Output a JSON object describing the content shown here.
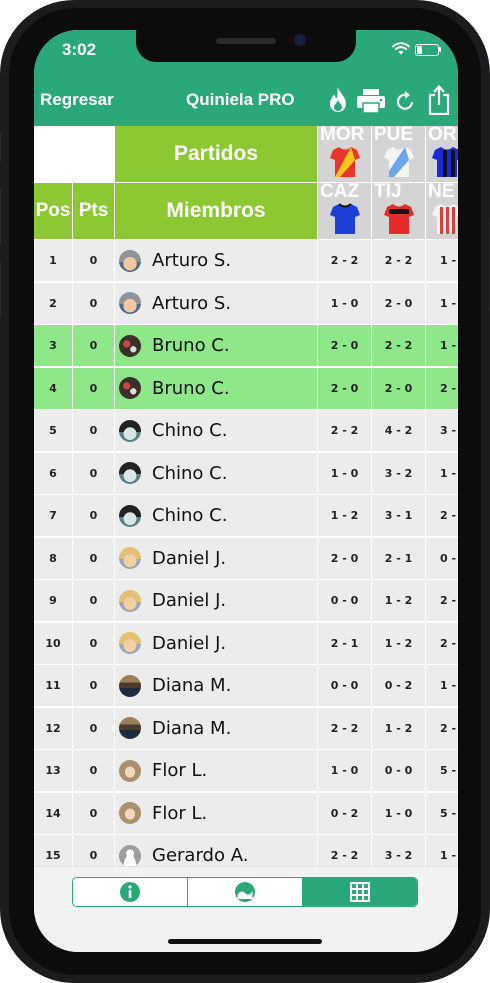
{
  "status": {
    "time": "3:02"
  },
  "nav": {
    "back_label": "Regresar",
    "title": "Quiniela PRO"
  },
  "header": {
    "partidos_label": "Partidos",
    "pos_label": "Pos",
    "pts_label": "Pts",
    "miembros_label": "Miembros"
  },
  "teams_row1": [
    {
      "abbr": "MOR",
      "jersey": "red-sash"
    },
    {
      "abbr": "PUE",
      "jersey": "white-blue-sash"
    },
    {
      "abbr": "OR",
      "jersey": "blue-black-stripes"
    }
  ],
  "teams_row2": [
    {
      "abbr": "CAZ",
      "jersey": "blue"
    },
    {
      "abbr": "TIJ",
      "jersey": "red-black"
    },
    {
      "abbr": "NE",
      "jersey": "red-white-stripes"
    }
  ],
  "colors": {
    "brand_green": "#2aa879",
    "header_green": "#8bc832",
    "highlight_row": "#8ee88a",
    "row_bg": "#ececec"
  },
  "rows": [
    {
      "pos": "1",
      "pts": "0",
      "name": "Arturo S.",
      "s1": "2 - 2",
      "s2": "2 - 2",
      "s3": "1 -",
      "avatar": "gray-hair",
      "highlight": false
    },
    {
      "pos": "2",
      "pts": "0",
      "name": "Arturo S.",
      "s1": "1 - 0",
      "s2": "2 - 0",
      "s3": "1 -",
      "avatar": "gray-hair",
      "highlight": false
    },
    {
      "pos": "3",
      "pts": "0",
      "name": "Bruno C.",
      "s1": "2 - 0",
      "s2": "2 - 2",
      "s3": "1 -",
      "avatar": "dark-pattern",
      "highlight": true
    },
    {
      "pos": "4",
      "pts": "0",
      "name": "Bruno C.",
      "s1": "2 - 0",
      "s2": "2 - 0",
      "s3": "2 -",
      "avatar": "dark-pattern",
      "highlight": true
    },
    {
      "pos": "5",
      "pts": "0",
      "name": "Chino C.",
      "s1": "2 - 2",
      "s2": "4 - 2",
      "s3": "3 -",
      "avatar": "black-hair",
      "highlight": false
    },
    {
      "pos": "6",
      "pts": "0",
      "name": "Chino C.",
      "s1": "1 - 0",
      "s2": "3 - 2",
      "s3": "1 -",
      "avatar": "black-hair",
      "highlight": false
    },
    {
      "pos": "7",
      "pts": "0",
      "name": "Chino C.",
      "s1": "1 - 2",
      "s2": "3 - 1",
      "s3": "2 -",
      "avatar": "black-hair",
      "highlight": false
    },
    {
      "pos": "8",
      "pts": "0",
      "name": "Daniel J.",
      "s1": "2 - 0",
      "s2": "2 - 1",
      "s3": "0 -",
      "avatar": "blonde",
      "highlight": false
    },
    {
      "pos": "9",
      "pts": "0",
      "name": "Daniel J.",
      "s1": "0 - 0",
      "s2": "1 - 2",
      "s3": "2 -",
      "avatar": "blonde",
      "highlight": false
    },
    {
      "pos": "10",
      "pts": "0",
      "name": "Daniel J.",
      "s1": "2 - 1",
      "s2": "1 - 2",
      "s3": "2 -",
      "avatar": "blonde",
      "highlight": false
    },
    {
      "pos": "11",
      "pts": "0",
      "name": "Diana M.",
      "s1": "0 - 0",
      "s2": "0 - 2",
      "s3": "1 -",
      "avatar": "landscape",
      "highlight": false
    },
    {
      "pos": "12",
      "pts": "0",
      "name": "Diana M.",
      "s1": "2 - 2",
      "s2": "1 - 2",
      "s3": "2 -",
      "avatar": "landscape",
      "highlight": false
    },
    {
      "pos": "13",
      "pts": "0",
      "name": "Flor L.",
      "s1": "1 - 0",
      "s2": "0 - 0",
      "s3": "5 -",
      "avatar": "woman",
      "highlight": false
    },
    {
      "pos": "14",
      "pts": "0",
      "name": "Flor L.",
      "s1": "0 - 2",
      "s2": "1 - 0",
      "s3": "5 -",
      "avatar": "woman",
      "highlight": false
    },
    {
      "pos": "15",
      "pts": "0",
      "name": "Gerardo A.",
      "s1": "2 - 2",
      "s2": "3 - 2",
      "s3": "1 -",
      "avatar": "default-user",
      "highlight": false
    }
  ],
  "bottom_tabs": [
    {
      "name": "info",
      "icon": "info-icon",
      "active": false
    },
    {
      "name": "stats",
      "icon": "gauge-icon",
      "active": false
    },
    {
      "name": "grid",
      "icon": "grid-icon",
      "active": true
    }
  ]
}
